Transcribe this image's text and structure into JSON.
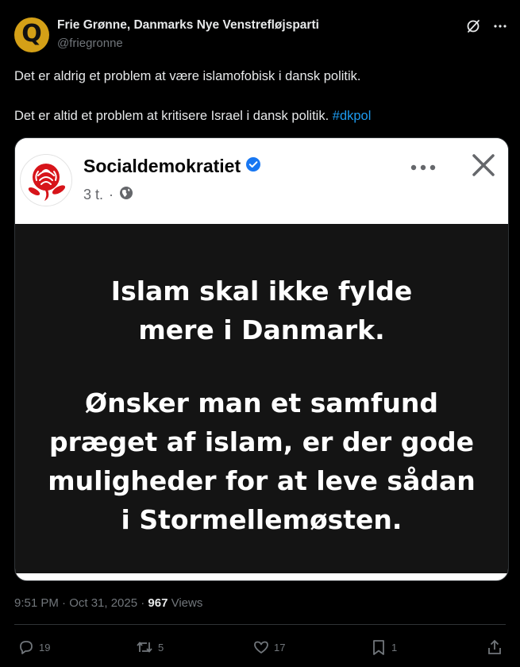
{
  "tweet": {
    "display_name": "Frie Grønne, Danmarks Nye Venstrefløjsparti",
    "handle": "@friegronne",
    "avatar_letter": "Q",
    "text_line1": "Det er aldrig et problem at være islamofobisk i dansk politik.",
    "text_line2": "Det er altid et problem at kritisere Israel i dansk politik.",
    "hashtag": "#dkpol",
    "timestamp": "9:51 PM · Oct 31, 2025 · ",
    "views_count": "967",
    "views_label": " Views"
  },
  "embedded_post": {
    "page_name": "Socialdemokratiet",
    "time_ago": "3 t.",
    "separator": "·",
    "lines_para1": [
      "Islam skal ikke fylde",
      "mere i Danmark."
    ],
    "lines_para2": [
      "Ønsker man et samfund",
      "præget af islam, er der gode",
      "muligheder for at leve sådan",
      "i Stormellemøsten."
    ]
  },
  "actions": {
    "replies": "19",
    "reposts": "5",
    "likes": "17",
    "bookmarks": "1"
  },
  "colors": {
    "background": "#000000",
    "text": "#e7e9ea",
    "muted": "#71767b",
    "link": "#1d9bf0",
    "verified": "#1877f2",
    "rose": "#d7141a"
  }
}
